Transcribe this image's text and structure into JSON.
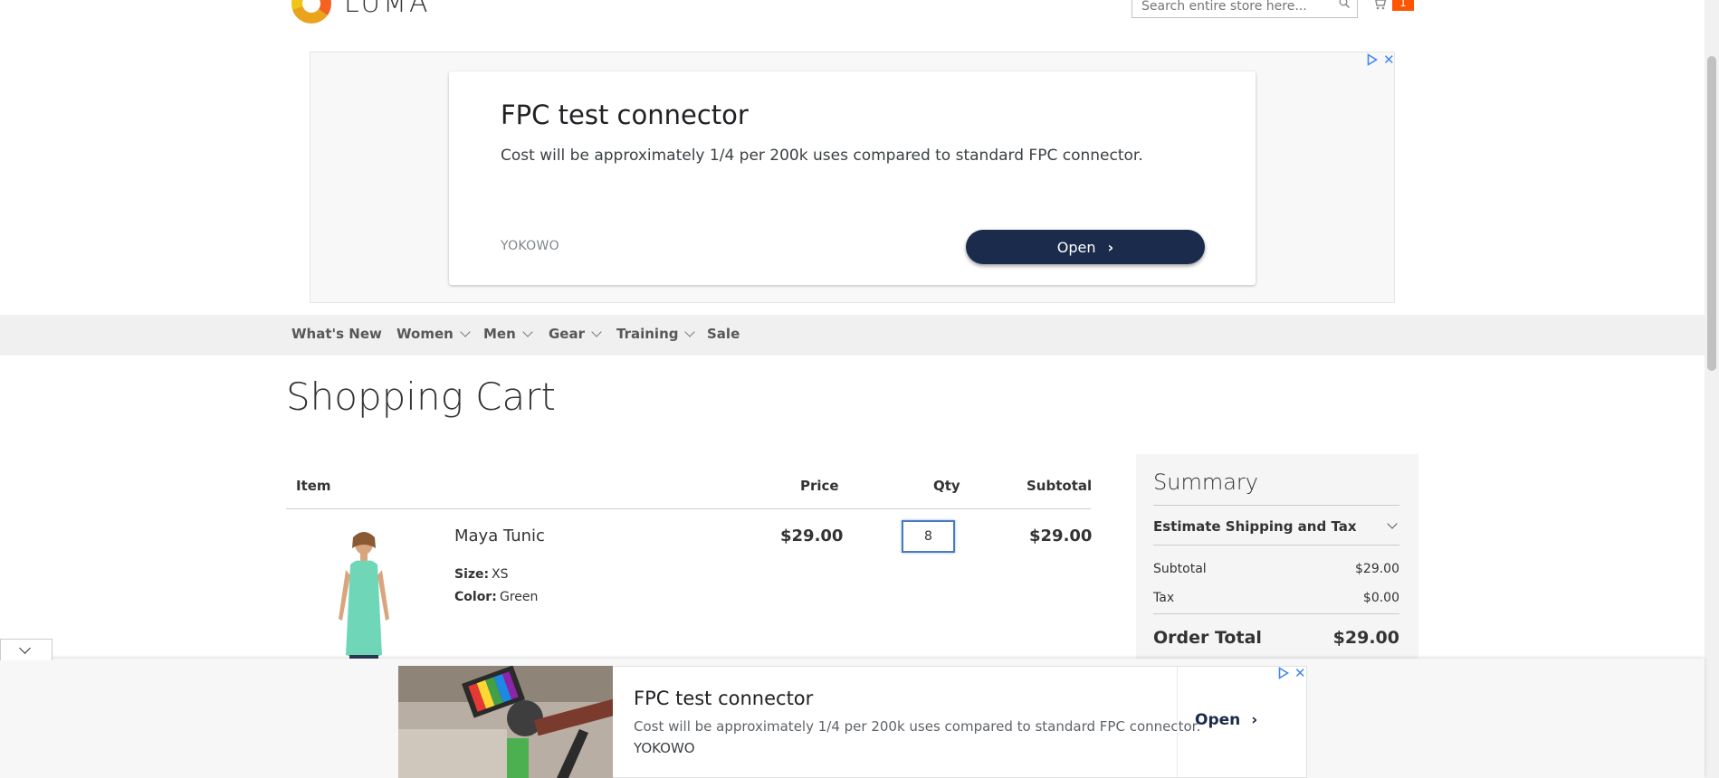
{
  "header": {
    "logo_text": "LUMA",
    "search_placeholder": "Search entire store here...",
    "cart_count": "1"
  },
  "top_ad": {
    "title": "FPC test connector",
    "description": "Cost will be approximately 1/4 per 200k uses compared to standard FPC connector.",
    "brand": "YOKOWO",
    "cta": "Open",
    "close": "✕"
  },
  "nav": {
    "items": [
      "What's New",
      "Women",
      "Men",
      "Gear",
      "Training",
      "Sale"
    ]
  },
  "page": {
    "title": "Shopping Cart"
  },
  "cart": {
    "headers": {
      "item": "Item",
      "price": "Price",
      "qty": "Qty",
      "subtotal": "Subtotal"
    },
    "items": [
      {
        "name": "Maya Tunic",
        "size_label": "Size:",
        "size": "XS",
        "color_label": "Color:",
        "color": "Green",
        "price": "$29.00",
        "qty": "8",
        "subtotal": "$29.00"
      }
    ]
  },
  "summary": {
    "title": "Summary",
    "estimate": "Estimate Shipping and Tax",
    "subtotal_label": "Subtotal",
    "subtotal": "$29.00",
    "tax_label": "Tax",
    "tax": "$0.00",
    "total_label": "Order Total",
    "total": "$29.00"
  },
  "anchor_ad": {
    "title": "FPC test connector",
    "description": "Cost will be approximately 1/4 per 200k uses compared to standard FPC connector.",
    "brand": "YOKOWO",
    "cta": "Open",
    "close": "✕"
  },
  "colors": {
    "accent": "#ff5501",
    "nav_bg": "#f0f0f0",
    "ad_button": "#1a2b4c",
    "adchoices": "#4285f4"
  }
}
